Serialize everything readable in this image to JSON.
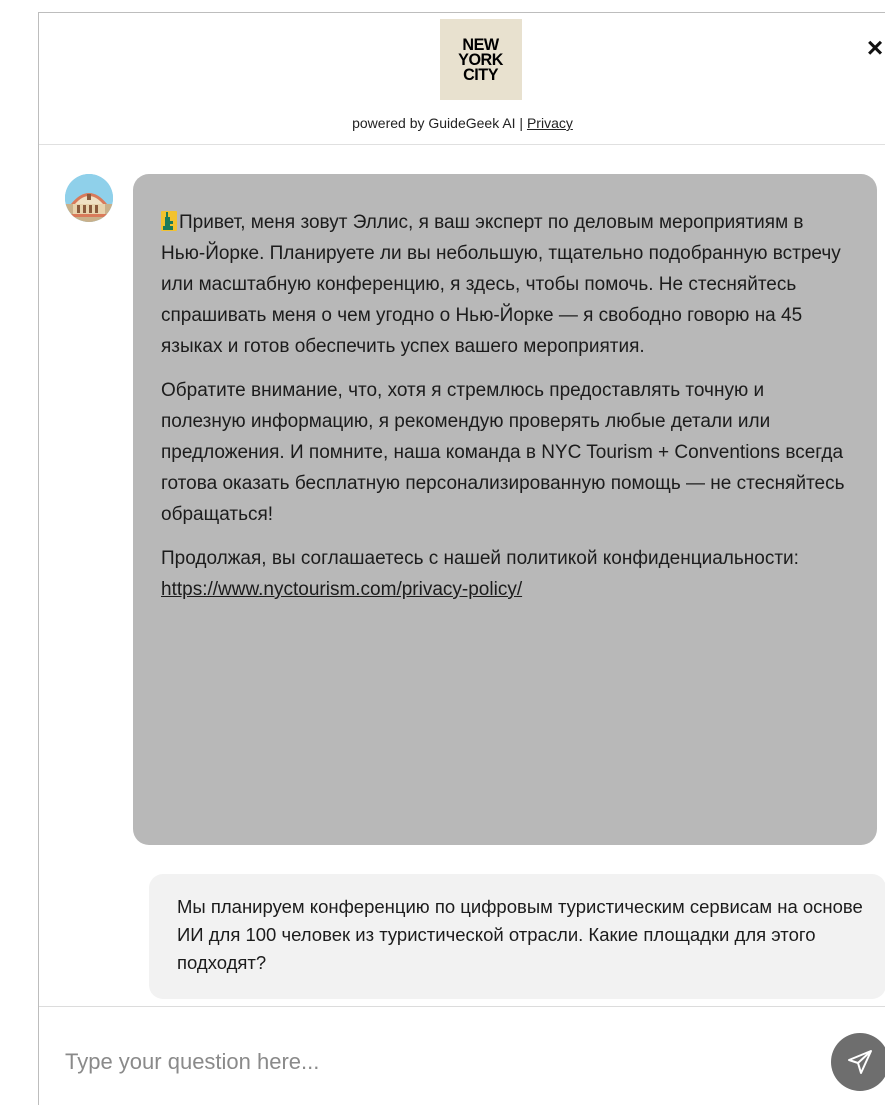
{
  "header": {
    "logo_lines": [
      "NEW",
      "YORK",
      "CITY"
    ],
    "powered_by": "powered by GuideGeek AI |",
    "privacy_link": "Privacy",
    "close_glyph": "×"
  },
  "messages": {
    "bot": {
      "p1": "Привет, меня зовут Эллис, я ваш эксперт по деловым мероприятиям в Нью-Йорке. Планируете ли вы небольшую, тщательно подобранную встречу или масштабную конференцию, я здесь, чтобы помочь. Не стесняйтесь спрашивать меня о чем угодно о Нью-Йорке — я свободно говорю на 45 языках и готов обеспечить успех вашего мероприятия.",
      "p2": "Обратите внимание, что, хотя я стремлюсь предоставлять точную и полезную информацию, я рекомендую проверять любые детали или предложения. И помните, наша команда в NYC Tourism + Conventions всегда готова оказать бесплатную персонализированную помощь — не стесняйтесь обращаться!",
      "p3_prefix": "Продолжая, вы соглашаетесь с нашей политикой конфиденциальности: ",
      "p3_link": "https://www.nyctourism.com/privacy-policy/"
    },
    "user": {
      "text": "Мы планируем конференцию по цифровым туристическим сервисам на основе ИИ для 100 человек из туристической отрасли. Какие площадки для этого подходят?"
    }
  },
  "composer": {
    "placeholder": "Type your question here..."
  },
  "icons": {
    "logo": "nyc-logo",
    "avatar": "building-avatar-icon",
    "emoji": "statue-of-liberty-icon",
    "send": "send-icon",
    "close": "close-icon"
  },
  "colors": {
    "bot_bubble": "#b8b8b8",
    "user_bubble": "#f2f2f2",
    "send_button": "#6e6e6e"
  }
}
